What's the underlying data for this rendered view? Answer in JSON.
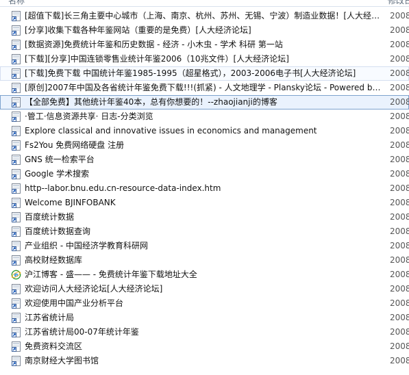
{
  "header": {
    "name_col": "名称",
    "date_col": "修改日期"
  },
  "bookmarks": [
    {
      "label": "[超值下载]长三角主要中心城市（上海、南京、杭州、苏州、无锡、宁波）制造业数据！[人大经济论坛]",
      "year": "2008",
      "icon": "shortcut-icon"
    },
    {
      "label": "[分享]收集下载各种年鉴网站（重要的是免费）[人大经济论坛]",
      "year": "2008",
      "icon": "shortcut-icon"
    },
    {
      "label": "[数据资源]免费统计年鉴和历史数据 - 经济 - 小木虫 - 学术 科研 第一站",
      "year": "2008",
      "icon": "shortcut-icon"
    },
    {
      "label": "[下载][分享]中国连锁零售业统计年鉴2006（10兆文件）[人大经济论坛]",
      "year": "2008",
      "icon": "shortcut-icon"
    },
    {
      "label": "[下载]免费下载 中国统计年鉴1985-1995（超星格式），2003-2006电子书[人大经济论坛]",
      "year": "2008",
      "icon": "shortcut-icon"
    },
    {
      "label": "[原创]2007年中国及各省统计年鉴免费下载!!!(抓紧) - 人文地理学 - Plansky论坛 - Powered by Discuz!",
      "year": "2008",
      "icon": "shortcut-icon"
    },
    {
      "label": "【全部免费】其他统计年鉴40本，总有你想要的！--zhaojianji的博客",
      "year": "2008",
      "icon": "shortcut-icon"
    },
    {
      "label": "·管工·信息资源共享· 日志-分类浏览",
      "year": "2008",
      "icon": "shortcut-icon"
    },
    {
      "label": "Explore classical and innovative issues in economics and management",
      "year": "2008",
      "icon": "shortcut-icon"
    },
    {
      "label": "Fs2You 免费网络硬盘  注册",
      "year": "2008",
      "icon": "shortcut-icon"
    },
    {
      "label": "GNS 统一检索平台",
      "year": "2008",
      "icon": "shortcut-icon"
    },
    {
      "label": "Google 学术搜索",
      "year": "2008",
      "icon": "shortcut-icon"
    },
    {
      "label": "http--labor.bnu.edu.cn-resource-data-index.htm",
      "year": "2008",
      "icon": "shortcut-icon"
    },
    {
      "label": "Welcome BJINFOBANK",
      "year": "2008",
      "icon": "shortcut-icon"
    },
    {
      "label": "百度统计数据",
      "year": "2008",
      "icon": "shortcut-icon"
    },
    {
      "label": "百度统计数据查询",
      "year": "2008",
      "icon": "shortcut-icon"
    },
    {
      "label": "产业组织 - 中国经济学教育科研网",
      "year": "2008",
      "icon": "shortcut-icon"
    },
    {
      "label": "高校财经数据库",
      "year": "2008",
      "icon": "shortcut-icon"
    },
    {
      "label": "沪江博客 - 盛—— - 免费统计年鉴下载地址大全",
      "year": "2008",
      "icon": "ie-shortcut-icon"
    },
    {
      "label": "欢迎访问人大经济论坛[人大经济论坛]",
      "year": "2008",
      "icon": "shortcut-icon"
    },
    {
      "label": "欢迎使用中国产业分析平台",
      "year": "2008",
      "icon": "shortcut-icon"
    },
    {
      "label": "江苏省统计局",
      "year": "2008",
      "icon": "shortcut-icon"
    },
    {
      "label": "江苏省统计局00-07年统计年鉴",
      "year": "2008",
      "icon": "shortcut-icon"
    },
    {
      "label": "免费资料交流区",
      "year": "2008",
      "icon": "shortcut-icon"
    },
    {
      "label": "南京财经大学图书馆",
      "year": "2008",
      "icon": "shortcut-icon"
    }
  ],
  "highlighted_index": 4,
  "selected_index": 6
}
